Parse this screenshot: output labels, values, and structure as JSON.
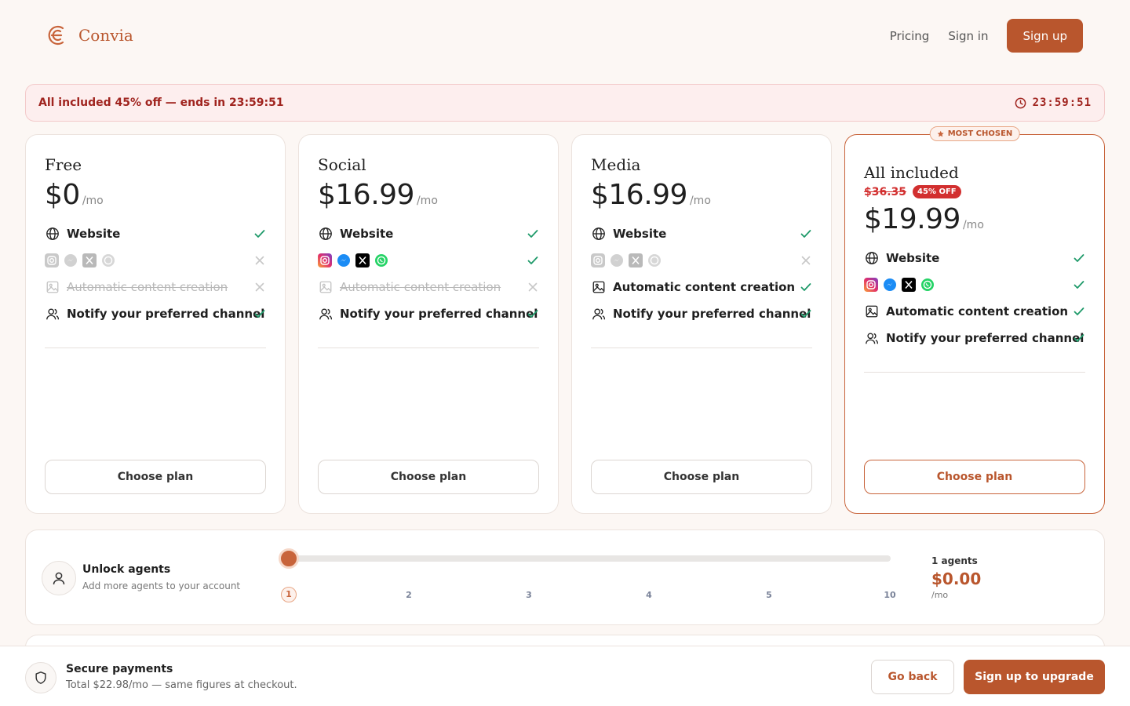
{
  "brand": {
    "name": "Convia",
    "accent": "#b9562d"
  },
  "nav": {
    "pricing": "Pricing",
    "signin": "Sign in",
    "signup": "Sign up"
  },
  "promo": {
    "text": "All included 45% off — ends in 23:59:51",
    "timer": "23:59:51",
    "icon": "clock-icon"
  },
  "plans": [
    {
      "name": "Free",
      "price": "$0",
      "per": "/mo",
      "features": {
        "website": "Website",
        "socials_enabled": false,
        "auto_content": "Automatic content creation",
        "auto_content_enabled": false,
        "notify": "Notify your preferred channel"
      },
      "cta": "Choose plan"
    },
    {
      "name": "Social",
      "price": "$16.99",
      "per": "/mo",
      "features": {
        "website": "Website",
        "socials_enabled": true,
        "auto_content": "Automatic content creation",
        "auto_content_enabled": false,
        "notify": "Notify your preferred channel"
      },
      "cta": "Choose plan"
    },
    {
      "name": "Media",
      "price": "$16.99",
      "per": "/mo",
      "features": {
        "website": "Website",
        "socials_enabled": false,
        "auto_content": "Automatic content creation",
        "auto_content_enabled": true,
        "notify": "Notify your preferred channel"
      },
      "cta": "Choose plan"
    },
    {
      "name": "All included",
      "old_price": "$36.35",
      "discount": "45% OFF",
      "price": "$19.99",
      "per": "/mo",
      "badge": "MOST CHOSEN",
      "features": {
        "website": "Website",
        "socials_enabled": true,
        "auto_content": "Automatic content creation",
        "auto_content_enabled": true,
        "notify": "Notify your preferred channel"
      },
      "cta": "Choose plan"
    }
  ],
  "social_icons": [
    "instagram-icon",
    "messenger-icon",
    "x-icon",
    "whatsapp-icon"
  ],
  "agents": {
    "title": "Unlock agents",
    "subtitle": "Add more agents to your account",
    "ticks": [
      "1",
      "2",
      "3",
      "4",
      "5",
      "10"
    ],
    "selected": "1",
    "count_label": "1 agents",
    "price": "$0.00",
    "per": "/mo"
  },
  "footer": {
    "title": "Secure payments",
    "subtitle": "Total $22.98/mo — same figures at checkout.",
    "back": "Go back",
    "upgrade": "Sign up to upgrade"
  }
}
